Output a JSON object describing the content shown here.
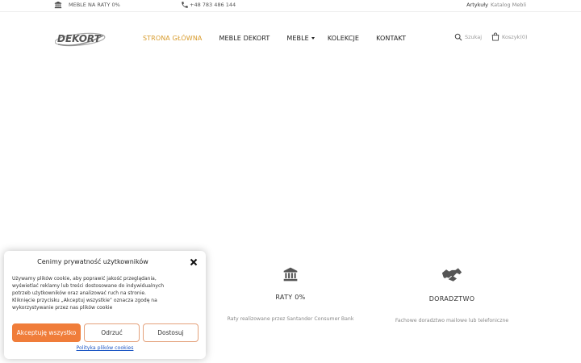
{
  "topbar": {
    "raty_label": "MEBLE NA RATY 0%",
    "phone": "+48 783 486 144",
    "link_articles": "Artykuły",
    "link_catalog": "Katalog Mebli"
  },
  "header": {
    "logo_text": "DEKORT",
    "nav": [
      {
        "label": "STRONA GŁÓWNA"
      },
      {
        "label": "MEBLE DEKORT"
      },
      {
        "label": "MEBLE"
      },
      {
        "label": "KOLEKCJE"
      },
      {
        "label": "KONTAKT"
      }
    ],
    "search_label": "Szukaj",
    "cart_label": "Koszyk",
    "cart_count": "(0)"
  },
  "features": [
    {
      "icon": "bank-icon",
      "title": "RATY 0%",
      "desc": "Raty realizowane przez Santander Consumer Bank"
    },
    {
      "icon": "handshake-icon",
      "title": "DORADZTWO",
      "desc": "Fachowe doradztwo mailowe lub telefoniczne"
    }
  ],
  "cookie": {
    "title": "Cenimy prywatność użytkowników",
    "text_lines": [
      "Używamy plików cookie, aby poprawić jakość przeglądania,",
      "wyświetlać reklamy lub treści dostosowane do indywidualnych",
      "potrzeb użytkowników oraz analizować ruch na stronie.",
      "Kliknięcie przycisku „Akceptuj wszystkie” oznacza zgodę na",
      "wykorzystywanie przez nas plików cookie"
    ],
    "accept_label": "Akceptuję wszystko",
    "deny_label": "Odrzuć",
    "customize_label": "Dostosuj",
    "policy_link": "Polityka plików cookies"
  },
  "colors": {
    "accent": "#d89b2c",
    "button_orange": "#f07d3a",
    "link_blue": "#1c56c4"
  }
}
